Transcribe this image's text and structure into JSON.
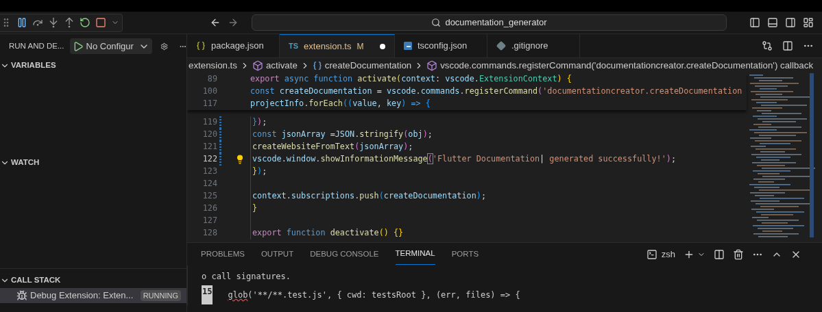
{
  "title_bar": {
    "search": "documentation_generator"
  },
  "sidebar": {
    "title": "RUN AND DE...",
    "config": "No Configur",
    "sections": [
      {
        "title": "VARIABLES",
        "expanded": true
      },
      {
        "title": "WATCH",
        "expanded": true
      },
      {
        "title": "CALL STACK",
        "expanded": true,
        "items": [
          {
            "label": "Debug Extension: Exten...",
            "badge": "RUNNING",
            "selected": true
          }
        ]
      }
    ]
  },
  "tabs": [
    {
      "kind": "json",
      "label": "package.json",
      "selected": false,
      "modified": false,
      "dirty": false
    },
    {
      "kind": "ts",
      "icon_text": "TS",
      "label": "extension.ts",
      "status": "M",
      "selected": true,
      "modified": true,
      "dirty": true
    },
    {
      "kind": "tsconfig",
      "label": "tsconfig.json",
      "selected": false,
      "modified": false,
      "dirty": false
    },
    {
      "kind": "git",
      "label": ".gitignore",
      "selected": false,
      "modified": false,
      "dirty": false
    }
  ],
  "breadcrumb": [
    {
      "kind": "file",
      "label": "extension.ts"
    },
    {
      "kind": "module",
      "label": "activate"
    },
    {
      "kind": "variable",
      "label": "createDocumentation"
    },
    {
      "kind": "module",
      "label": "vscode.commands.registerCommand('documentationcreator.createDocumentation') callback"
    }
  ],
  "sticky_lines": [
    {
      "number": "89",
      "tokens": [
        {
          "kind": "kw",
          "text": "export "
        },
        {
          "kind": "st",
          "text": "async function "
        },
        {
          "kind": "fn",
          "text": "activate"
        },
        {
          "kind": "b1",
          "text": "("
        },
        {
          "kind": "v",
          "text": "context"
        },
        {
          "kind": "p",
          "text": ": "
        },
        {
          "kind": "v",
          "text": "vscode"
        },
        {
          "kind": "p",
          "text": "."
        },
        {
          "kind": "ty",
          "text": "ExtensionContext"
        },
        {
          "kind": "b1",
          "text": ") {"
        }
      ]
    },
    {
      "number": "100",
      "tokens": [
        {
          "kind": "st",
          "text": "const "
        },
        {
          "kind": "v",
          "text": "createDocumentation"
        },
        {
          "kind": "p",
          "text": " = "
        },
        {
          "kind": "v",
          "text": "vscode"
        },
        {
          "kind": "p",
          "text": "."
        },
        {
          "kind": "v",
          "text": "commands"
        },
        {
          "kind": "p",
          "text": "."
        },
        {
          "kind": "fn",
          "text": "registerCommand"
        },
        {
          "kind": "b2",
          "text": "("
        },
        {
          "kind": "s",
          "text": "'documentationcreator.createDocumentation"
        }
      ]
    },
    {
      "number": "117",
      "tokens": [
        {
          "kind": "v",
          "text": "projectInfo"
        },
        {
          "kind": "p",
          "text": "."
        },
        {
          "kind": "fn",
          "text": "forEach"
        },
        {
          "kind": "b3",
          "text": "(("
        },
        {
          "kind": "v",
          "text": "value"
        },
        {
          "kind": "p",
          "text": ", "
        },
        {
          "kind": "v",
          "text": "key"
        },
        {
          "kind": "b3",
          "text": ")"
        },
        {
          "kind": "st",
          "text": " => "
        },
        {
          "kind": "b3",
          "text": "{"
        }
      ]
    }
  ],
  "lines": [
    {
      "number": "119",
      "modified": true,
      "lightbulb": false,
      "current": false,
      "tokens": [
        {
          "kind": "b3",
          "text": "}"
        },
        {
          "kind": "b2",
          "text": ")"
        },
        {
          "kind": "p",
          "text": ";"
        }
      ]
    },
    {
      "number": "120",
      "modified": true,
      "lightbulb": false,
      "current": false,
      "tokens": [
        {
          "kind": "st",
          "text": "const "
        },
        {
          "kind": "v",
          "text": "jsonArray"
        },
        {
          "kind": "p",
          "text": " ="
        },
        {
          "kind": "v",
          "text": "JSON"
        },
        {
          "kind": "p",
          "text": "."
        },
        {
          "kind": "fn",
          "text": "stringify"
        },
        {
          "kind": "b2",
          "text": "("
        },
        {
          "kind": "v",
          "text": "obj"
        },
        {
          "kind": "b2",
          "text": ")"
        },
        {
          "kind": "p",
          "text": ";"
        }
      ]
    },
    {
      "number": "121",
      "modified": true,
      "lightbulb": false,
      "current": false,
      "tokens": [
        {
          "kind": "fn",
          "text": "createWebsiteFromText"
        },
        {
          "kind": "b2",
          "text": "("
        },
        {
          "kind": "v",
          "text": "jsonArray"
        },
        {
          "kind": "b2",
          "text": ")"
        },
        {
          "kind": "p",
          "text": ";"
        }
      ]
    },
    {
      "number": "122",
      "modified": true,
      "lightbulb": true,
      "current": true,
      "tokens": [
        {
          "kind": "v",
          "text": "vscode"
        },
        {
          "kind": "p",
          "text": "."
        },
        {
          "kind": "v",
          "text": "window"
        },
        {
          "kind": "p",
          "text": "."
        },
        {
          "kind": "fn",
          "text": "showInformationMessage"
        },
        {
          "kind": "bm",
          "text": "("
        },
        {
          "kind": "s",
          "text": "'Flutter Documentation"
        },
        {
          "kind": "caret",
          "text": "|"
        },
        {
          "kind": "s",
          "text": " generated successfully!'"
        },
        {
          "kind": "b2",
          "text": ")"
        },
        {
          "kind": "p",
          "text": ";"
        }
      ]
    },
    {
      "number": "123",
      "modified": false,
      "lightbulb": false,
      "current": false,
      "tokens": [
        {
          "kind": "b1",
          "text": "}"
        },
        {
          "kind": "b3",
          "text": ")"
        },
        {
          "kind": "p",
          "text": ";"
        }
      ]
    },
    {
      "number": "124",
      "modified": false,
      "lightbulb": false,
      "current": false
    },
    {
      "number": "125",
      "modified": false,
      "lightbulb": false,
      "current": false,
      "tokens": [
        {
          "kind": "v",
          "text": "context"
        },
        {
          "kind": "p",
          "text": "."
        },
        {
          "kind": "v",
          "text": "subscriptions"
        },
        {
          "kind": "p",
          "text": "."
        },
        {
          "kind": "fn",
          "text": "push"
        },
        {
          "kind": "b3",
          "text": "("
        },
        {
          "kind": "v",
          "text": "createDocumentation"
        },
        {
          "kind": "b3",
          "text": ")"
        },
        {
          "kind": "p",
          "text": ";"
        }
      ]
    },
    {
      "number": "126",
      "modified": false,
      "lightbulb": false,
      "current": false,
      "tokens": [
        {
          "kind": "b1",
          "text": "}"
        }
      ]
    },
    {
      "number": "127",
      "modified": false,
      "lightbulb": false,
      "current": false
    },
    {
      "number": "128",
      "modified": false,
      "lightbulb": false,
      "current": false,
      "tokens": [
        {
          "kind": "kw",
          "text": "export "
        },
        {
          "kind": "st",
          "text": "function "
        },
        {
          "kind": "fn",
          "text": "deactivate"
        },
        {
          "kind": "b1",
          "text": "() {}"
        }
      ]
    }
  ],
  "panel": {
    "tabs": [
      {
        "label": "PROBLEMS",
        "selected": false
      },
      {
        "label": "OUTPUT",
        "selected": false
      },
      {
        "label": "DEBUG CONSOLE",
        "selected": false
      },
      {
        "label": "TERMINAL",
        "selected": true
      },
      {
        "label": "PORTS",
        "selected": false
      }
    ],
    "shell": "zsh",
    "terminal": [
      {
        "kind": "text",
        "text": "o call signatures."
      },
      {
        "kind": "numbered",
        "number": "15",
        "squiggled": "glob",
        "text": "('**/**.test.js', { cwd: testsRoot }, (err, files) => {"
      }
    ]
  }
}
